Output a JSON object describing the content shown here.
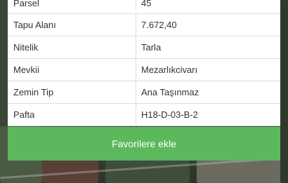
{
  "parcel_info": {
    "rows": [
      {
        "key": "Parsel",
        "value": "45"
      },
      {
        "key": "Tapu Alanı",
        "value": "7.672,40"
      },
      {
        "key": "Nitelik",
        "value": "Tarla"
      },
      {
        "key": "Mevkii",
        "value": "Mezarlıkcivarı"
      },
      {
        "key": "Zemin Tip",
        "value": "Ana Taşınmaz"
      },
      {
        "key": "Pafta",
        "value": "H18-D-03-B-2"
      }
    ]
  },
  "actions": {
    "favorite_label": "Favorilere ekle"
  },
  "colors": {
    "button": "#5cb85c",
    "border": "#dddddd"
  }
}
